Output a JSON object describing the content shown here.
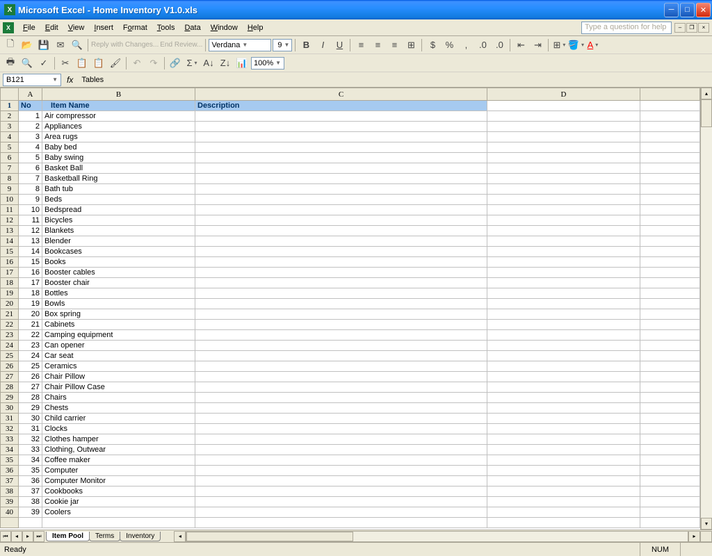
{
  "titlebar": {
    "title": "Microsoft Excel - Home Inventory V1.0.xls"
  },
  "menu": {
    "file": "File",
    "edit": "Edit",
    "view": "View",
    "insert": "Insert",
    "format": "Format",
    "tools": "Tools",
    "data": "Data",
    "window": "Window",
    "help": "Help"
  },
  "helpbox": {
    "placeholder": "Type a question for help"
  },
  "toolbar": {
    "reply": "Reply with Changes...",
    "end": "End Review...",
    "font": "Verdana",
    "size": "9",
    "zoom": "100%"
  },
  "namebox": {
    "ref": "B121"
  },
  "formula": {
    "value": "Tables"
  },
  "headers": {
    "no": "No",
    "item": "Item Name",
    "desc": "Description"
  },
  "columns": [
    "A",
    "B",
    "C",
    "D"
  ],
  "rows": [
    {
      "n": 1,
      "name": "Air compressor"
    },
    {
      "n": 2,
      "name": "Appliances"
    },
    {
      "n": 3,
      "name": "Area rugs"
    },
    {
      "n": 4,
      "name": "Baby bed"
    },
    {
      "n": 5,
      "name": "Baby swing"
    },
    {
      "n": 6,
      "name": "Basket Ball"
    },
    {
      "n": 7,
      "name": "Basketball Ring"
    },
    {
      "n": 8,
      "name": "Bath tub"
    },
    {
      "n": 9,
      "name": "Beds"
    },
    {
      "n": 10,
      "name": "Bedspread"
    },
    {
      "n": 11,
      "name": "Bicycles"
    },
    {
      "n": 12,
      "name": "Blankets"
    },
    {
      "n": 13,
      "name": "Blender"
    },
    {
      "n": 14,
      "name": "Bookcases"
    },
    {
      "n": 15,
      "name": "Books"
    },
    {
      "n": 16,
      "name": "Booster cables"
    },
    {
      "n": 17,
      "name": "Booster chair"
    },
    {
      "n": 18,
      "name": "Bottles"
    },
    {
      "n": 19,
      "name": "Bowls"
    },
    {
      "n": 20,
      "name": "Box spring"
    },
    {
      "n": 21,
      "name": "Cabinets"
    },
    {
      "n": 22,
      "name": "Camping equipment"
    },
    {
      "n": 23,
      "name": "Can opener"
    },
    {
      "n": 24,
      "name": "Car seat"
    },
    {
      "n": 25,
      "name": "Ceramics"
    },
    {
      "n": 26,
      "name": "Chair Pillow"
    },
    {
      "n": 27,
      "name": "Chair Pillow Case"
    },
    {
      "n": 28,
      "name": "Chairs"
    },
    {
      "n": 29,
      "name": "Chests"
    },
    {
      "n": 30,
      "name": "Child carrier"
    },
    {
      "n": 31,
      "name": "Clocks"
    },
    {
      "n": 32,
      "name": "Clothes hamper"
    },
    {
      "n": 33,
      "name": "Clothing, Outwear"
    },
    {
      "n": 34,
      "name": "Coffee maker"
    },
    {
      "n": 35,
      "name": "Computer"
    },
    {
      "n": 36,
      "name": "Computer Monitor"
    },
    {
      "n": 37,
      "name": "Cookbooks"
    },
    {
      "n": 38,
      "name": "Cookie jar"
    },
    {
      "n": 39,
      "name": "Coolers"
    }
  ],
  "tabs": {
    "t1": "Item Pool",
    "t2": "Terms",
    "t3": "Inventory"
  },
  "status": {
    "ready": "Ready",
    "num": "NUM"
  }
}
